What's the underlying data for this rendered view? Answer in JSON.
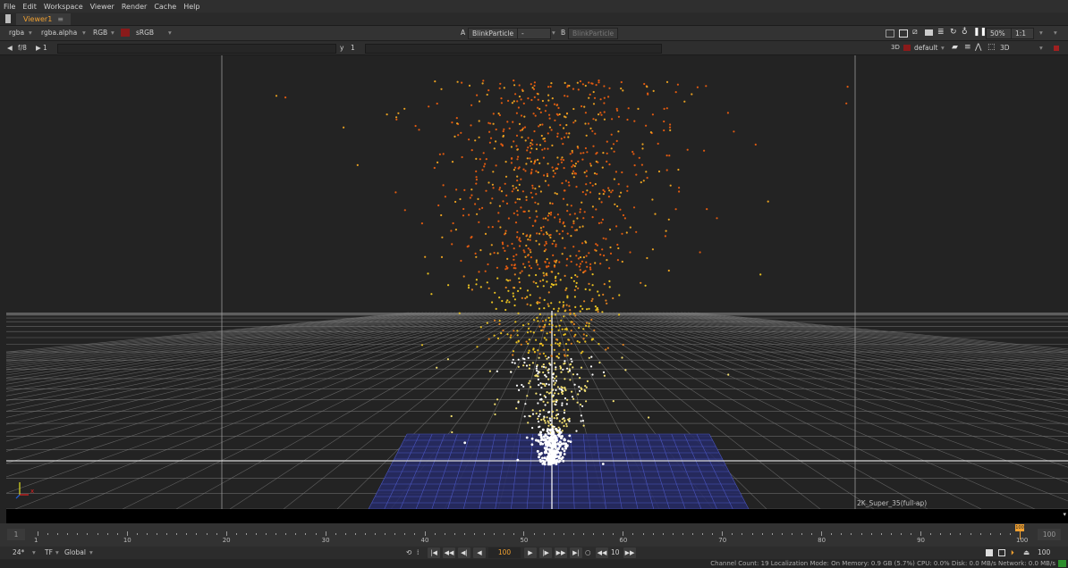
{
  "menubar": {
    "items": [
      "File",
      "Edit",
      "Workspace",
      "Viewer",
      "Render",
      "Cache",
      "Help"
    ]
  },
  "tabs": [
    {
      "label": "Viewer1"
    }
  ],
  "toolbar1": {
    "channels": "rgba",
    "alpha": "rgba.alpha",
    "display": "RGB",
    "lut": "sRGB",
    "input_a_prefix": "A",
    "input_a": "BlinkParticle",
    "input_a_op": "-",
    "input_b_prefix": "B",
    "input_b": "BlinkParticle",
    "zoom": "50%",
    "ratio": "1:1"
  },
  "toolbar2": {
    "fstop": "f/8",
    "gain": "1",
    "gamma_label": "y",
    "gamma": "1",
    "colorspace": "default",
    "view_mode": "3D"
  },
  "viewport": {
    "format_label": "2K_Super_35(full-ap)",
    "axis_x": "x"
  },
  "timeline": {
    "start_frame": "1",
    "end_frame": "100",
    "current_frame": "100",
    "ticks": [
      "1",
      "10",
      "20",
      "30",
      "40",
      "50",
      "60",
      "70",
      "80",
      "90",
      "100"
    ]
  },
  "controls": {
    "fps": "24*",
    "tf": "TF",
    "scope": "Global",
    "frame": "100",
    "increment": "10",
    "end": "100"
  },
  "status": {
    "text": "Channel Count: 19 Localization Mode: On Memory: 0.9 GB (5.7%) CPU: 0.0% Disk: 0.0 MB/s Network: 0.0 MB/s"
  },
  "colors": {
    "accent": "#f0a030",
    "particle_hot": "#e04010",
    "particle_mid": "#f0c020",
    "particle_core": "#ffffff",
    "ground_plane": "#2a2f7a",
    "grid": "#8a8a8a"
  }
}
